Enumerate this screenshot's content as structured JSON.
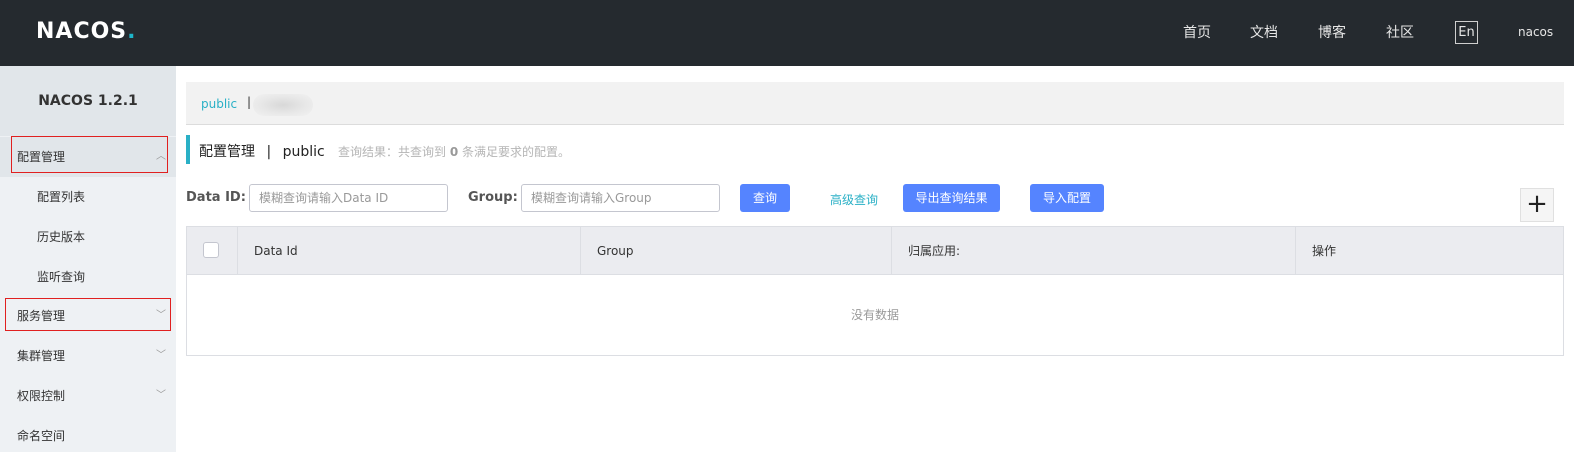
{
  "header": {
    "logo_text": "NACOS",
    "logo_dot": ".",
    "nav": [
      "首页",
      "文档",
      "博客",
      "社区"
    ],
    "lang": "En",
    "user": "nacos"
  },
  "sidebar": {
    "title": "NACOS 1.2.1",
    "items": [
      {
        "label": "配置管理"
      },
      {
        "label": "配置列表"
      },
      {
        "label": "历史版本"
      },
      {
        "label": "监听查询"
      },
      {
        "label": "服务管理"
      },
      {
        "label": "集群管理"
      },
      {
        "label": "权限控制"
      },
      {
        "label": "命名空间"
      }
    ]
  },
  "breadcrumb": {
    "namespace": "public",
    "separator": "|"
  },
  "page": {
    "title": "配置管理",
    "title_sep": "|",
    "namespace": "public",
    "result_prefix": "查询结果：共查询到",
    "result_count": "0",
    "result_suffix": "条满足要求的配置。"
  },
  "search": {
    "data_id_label": "Data ID:",
    "data_id_placeholder": "模糊查询请输入Data ID",
    "group_label": "Group:",
    "group_placeholder": "模糊查询请输入Group",
    "query_button": "查询",
    "advanced_link": "高级查询",
    "export_button": "导出查询结果",
    "import_button": "导入配置",
    "add_button": "+"
  },
  "table": {
    "columns": [
      "Data Id",
      "Group",
      "归属应用:",
      "操作"
    ],
    "empty_text": "没有数据"
  },
  "colors": {
    "header_bg": "#252a2f",
    "accent": "#2ab0c6",
    "primary_button": "#5584ff",
    "highlight_box": "#e02020"
  }
}
